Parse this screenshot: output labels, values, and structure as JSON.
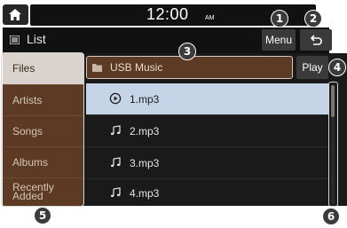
{
  "status": {
    "time": "12:00",
    "ampm": "AM"
  },
  "header": {
    "title": "List",
    "menu_label": "Menu"
  },
  "icons": {
    "home": "home-icon",
    "back": "back-arrow-icon",
    "list": "list-icon",
    "folder": "folder-icon",
    "play": "play-circle-icon",
    "note": "music-note-icon"
  },
  "sidebar": {
    "items": [
      {
        "label": "Files",
        "selected": true
      },
      {
        "label": "Artists",
        "selected": false
      },
      {
        "label": "Songs",
        "selected": false
      },
      {
        "label": "Albums",
        "selected": false
      },
      {
        "label": "Recently Added",
        "selected": false
      }
    ]
  },
  "folder": {
    "name": "USB Music",
    "play_label": "Play"
  },
  "files": [
    {
      "name": "1.mp3",
      "playing": true
    },
    {
      "name": "2.mp3",
      "playing": false
    },
    {
      "name": "3.mp3",
      "playing": false
    },
    {
      "name": "4.mp3",
      "playing": false
    }
  ],
  "callouts": [
    "1",
    "2",
    "3",
    "4",
    "5",
    "6"
  ],
  "colors": {
    "accent_brown": "#5c3a24",
    "selected_row": "#c5d4e6",
    "background": "#1a1a1a"
  }
}
